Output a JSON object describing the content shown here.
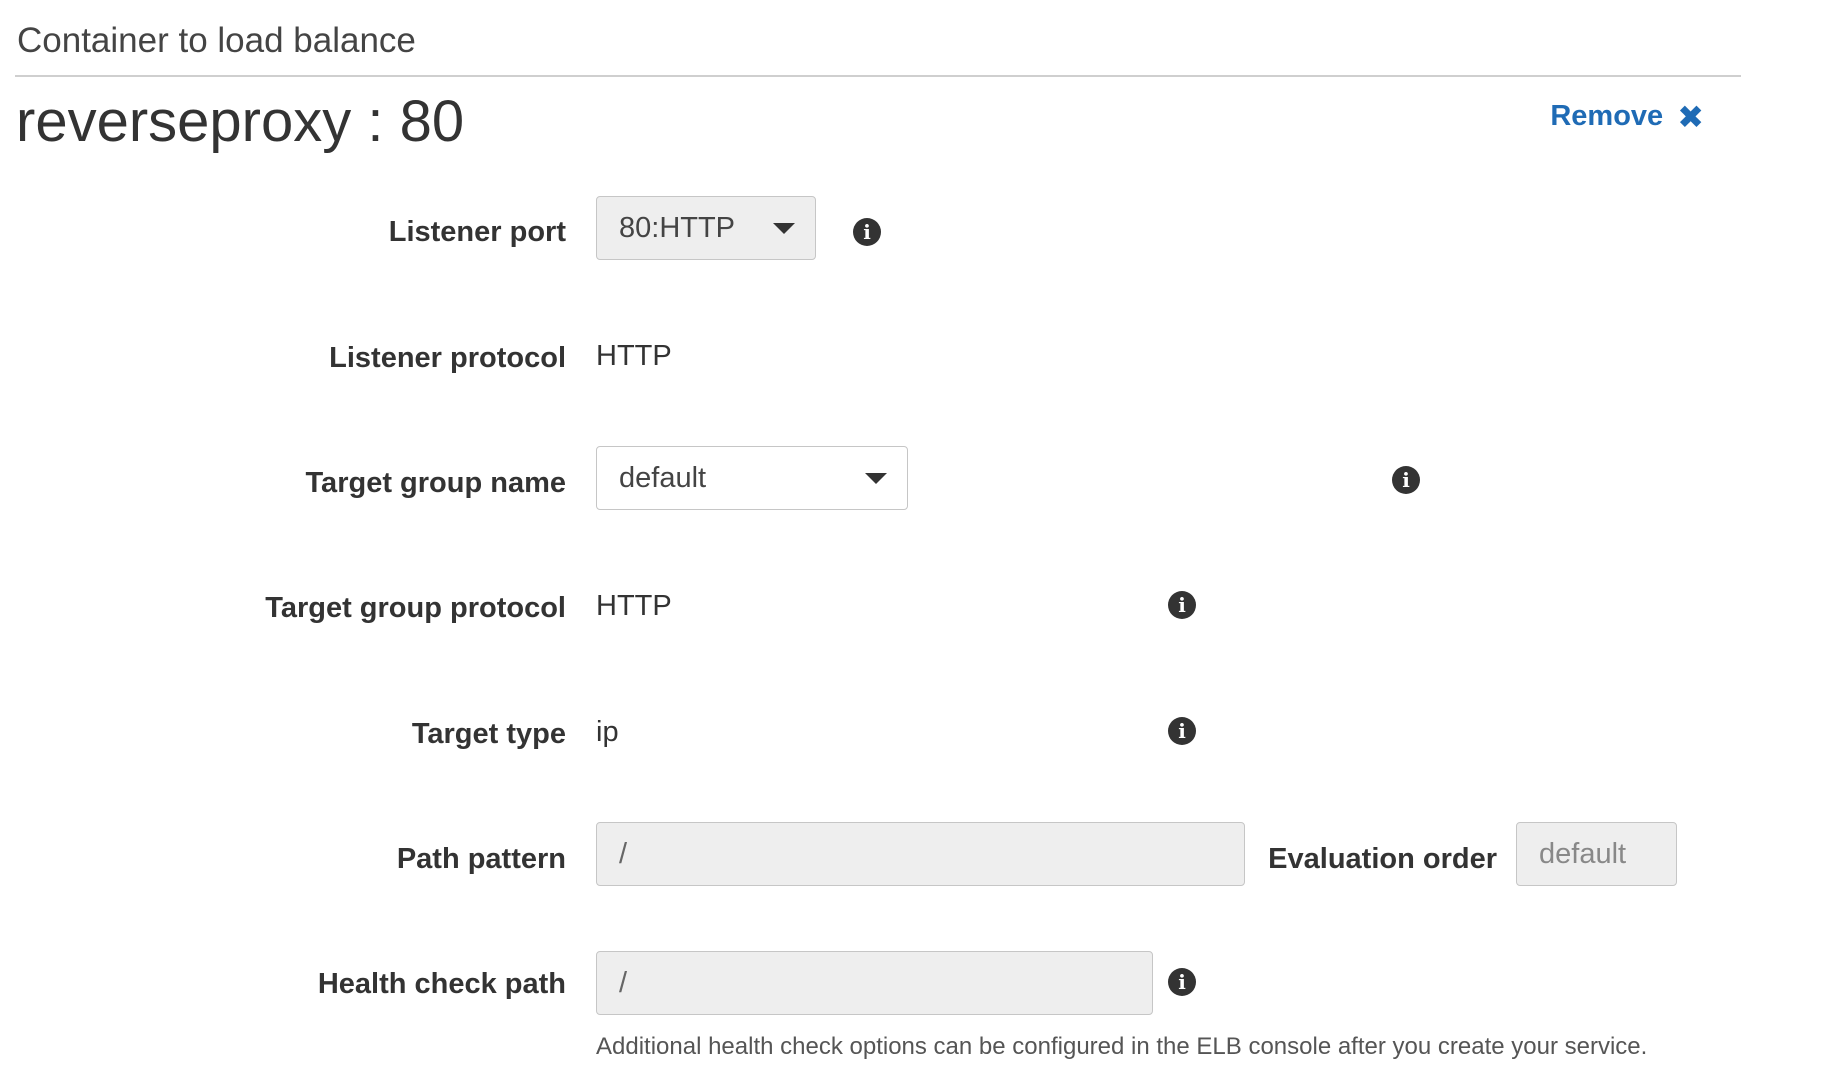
{
  "section": {
    "title": "Container to load balance"
  },
  "header": {
    "title": "reverseproxy : 80",
    "remove_label": "Remove",
    "remove_icon": "close-icon"
  },
  "form": {
    "listener_port": {
      "label": "Listener port",
      "value": "80:HTTP"
    },
    "listener_protocol": {
      "label": "Listener protocol",
      "value": "HTTP"
    },
    "target_group_name": {
      "label": "Target group name",
      "value": "default"
    },
    "target_group_protocol": {
      "label": "Target group protocol",
      "value": "HTTP"
    },
    "target_type": {
      "label": "Target type",
      "value": "ip"
    },
    "path_pattern": {
      "label": "Path pattern",
      "value": "/"
    },
    "evaluation_order": {
      "label": "Evaluation order",
      "placeholder": "default"
    },
    "health_check_path": {
      "label": "Health check path",
      "value": "/",
      "help": "Additional health check options can be configured in the ELB console after you create your service."
    }
  },
  "colors": {
    "link": "#1f6bb5",
    "text": "#333333",
    "input_bg": "#eeeeee",
    "border": "#c6c6c6"
  },
  "icons": {
    "info": "info-icon",
    "dropdown": "caret-down-icon"
  }
}
